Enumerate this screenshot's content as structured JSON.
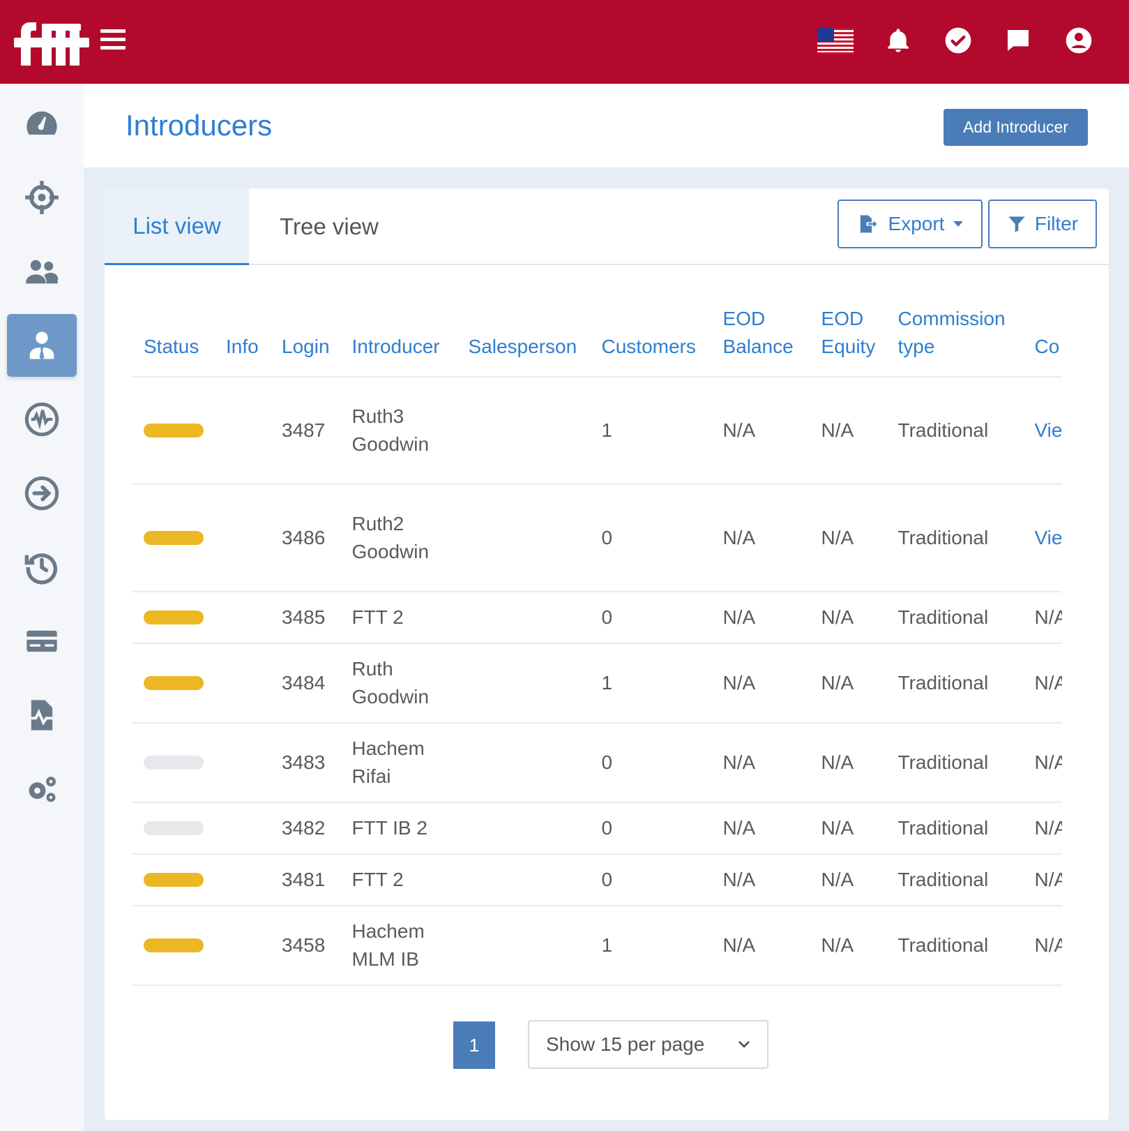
{
  "header": {
    "logo_text": "ftt",
    "icons": [
      "menu-icon",
      "us-flag-icon",
      "bell-icon",
      "check-circle-icon",
      "chat-icon",
      "user-circle-icon"
    ]
  },
  "sidebar": {
    "items": [
      {
        "name": "dashboard",
        "icon": "speedometer-icon"
      },
      {
        "name": "targets",
        "icon": "crosshair-icon"
      },
      {
        "name": "customers",
        "icon": "users-icon"
      },
      {
        "name": "introducers",
        "icon": "user-tie-icon",
        "active": true
      },
      {
        "name": "monitoring",
        "icon": "activity-circle-icon"
      },
      {
        "name": "transfers",
        "icon": "arrow-right-circle-icon"
      },
      {
        "name": "history",
        "icon": "history-icon"
      },
      {
        "name": "payments",
        "icon": "card-icon"
      },
      {
        "name": "reports",
        "icon": "report-icon"
      },
      {
        "name": "settings",
        "icon": "gears-icon"
      }
    ]
  },
  "page": {
    "title": "Introducers",
    "add_button": "Add Introducer"
  },
  "tabs": {
    "list": "List view",
    "tree": "Tree view"
  },
  "toolbar": {
    "export": "Export",
    "filter": "Filter"
  },
  "table": {
    "headers": {
      "status": "Status",
      "info": "Info",
      "login": "Login",
      "introducer": "Introducer",
      "salesperson": "Salesperson",
      "customers": "Customers",
      "eod_balance": "EOD Balance",
      "eod_equity": "EOD Equity",
      "commission_type": "Commission type",
      "commission_period": "Co pe"
    },
    "rows": [
      {
        "status": "active",
        "login": "3487",
        "introducer_l1": "Ruth3",
        "introducer_l2": "Goodwin",
        "customers": "1",
        "eod_balance": "N/A",
        "eod_equity": "N/A",
        "commission_type": "Traditional",
        "last": "Vie"
      },
      {
        "status": "active",
        "login": "3486",
        "introducer_l1": "Ruth2",
        "introducer_l2": "Goodwin",
        "customers": "0",
        "eod_balance": "N/A",
        "eod_equity": "N/A",
        "commission_type": "Traditional",
        "last": "Vie"
      },
      {
        "status": "active",
        "login": "3485",
        "introducer_l1": "FTT 2",
        "introducer_l2": "",
        "customers": "0",
        "eod_balance": "N/A",
        "eod_equity": "N/A",
        "commission_type": "Traditional",
        "last": "N/A"
      },
      {
        "status": "active",
        "login": "3484",
        "introducer_l1": "Ruth",
        "introducer_l2": "Goodwin",
        "customers": "1",
        "eod_balance": "N/A",
        "eod_equity": "N/A",
        "commission_type": "Traditional",
        "last": "N/A"
      },
      {
        "status": "inactive",
        "login": "3483",
        "introducer_l1": "Hachem",
        "introducer_l2": "Rifai",
        "customers": "0",
        "eod_balance": "N/A",
        "eod_equity": "N/A",
        "commission_type": "Traditional",
        "last": "N/A"
      },
      {
        "status": "inactive",
        "login": "3482",
        "introducer_l1": "FTT IB 2",
        "introducer_l2": "",
        "customers": "0",
        "eod_balance": "N/A",
        "eod_equity": "N/A",
        "commission_type": "Traditional",
        "last": "N/A"
      },
      {
        "status": "active",
        "login": "3481",
        "introducer_l1": "FTT 2",
        "introducer_l2": "",
        "customers": "0",
        "eod_balance": "N/A",
        "eod_equity": "N/A",
        "commission_type": "Traditional",
        "last": "N/A"
      },
      {
        "status": "active",
        "login": "3458",
        "introducer_l1": "Hachem",
        "introducer_l2": "MLM IB",
        "customers": "1",
        "eod_balance": "N/A",
        "eod_equity": "N/A",
        "commission_type": "Traditional",
        "last": "N/A"
      }
    ]
  },
  "pagination": {
    "current_page": "1",
    "per_page": "Show 15 per page"
  },
  "colors": {
    "brand_red": "#b3092d",
    "accent_blue": "#2f7ed0",
    "button_blue": "#4a7db8",
    "status_active": "#ebb824",
    "status_inactive": "#e6e8eb"
  }
}
